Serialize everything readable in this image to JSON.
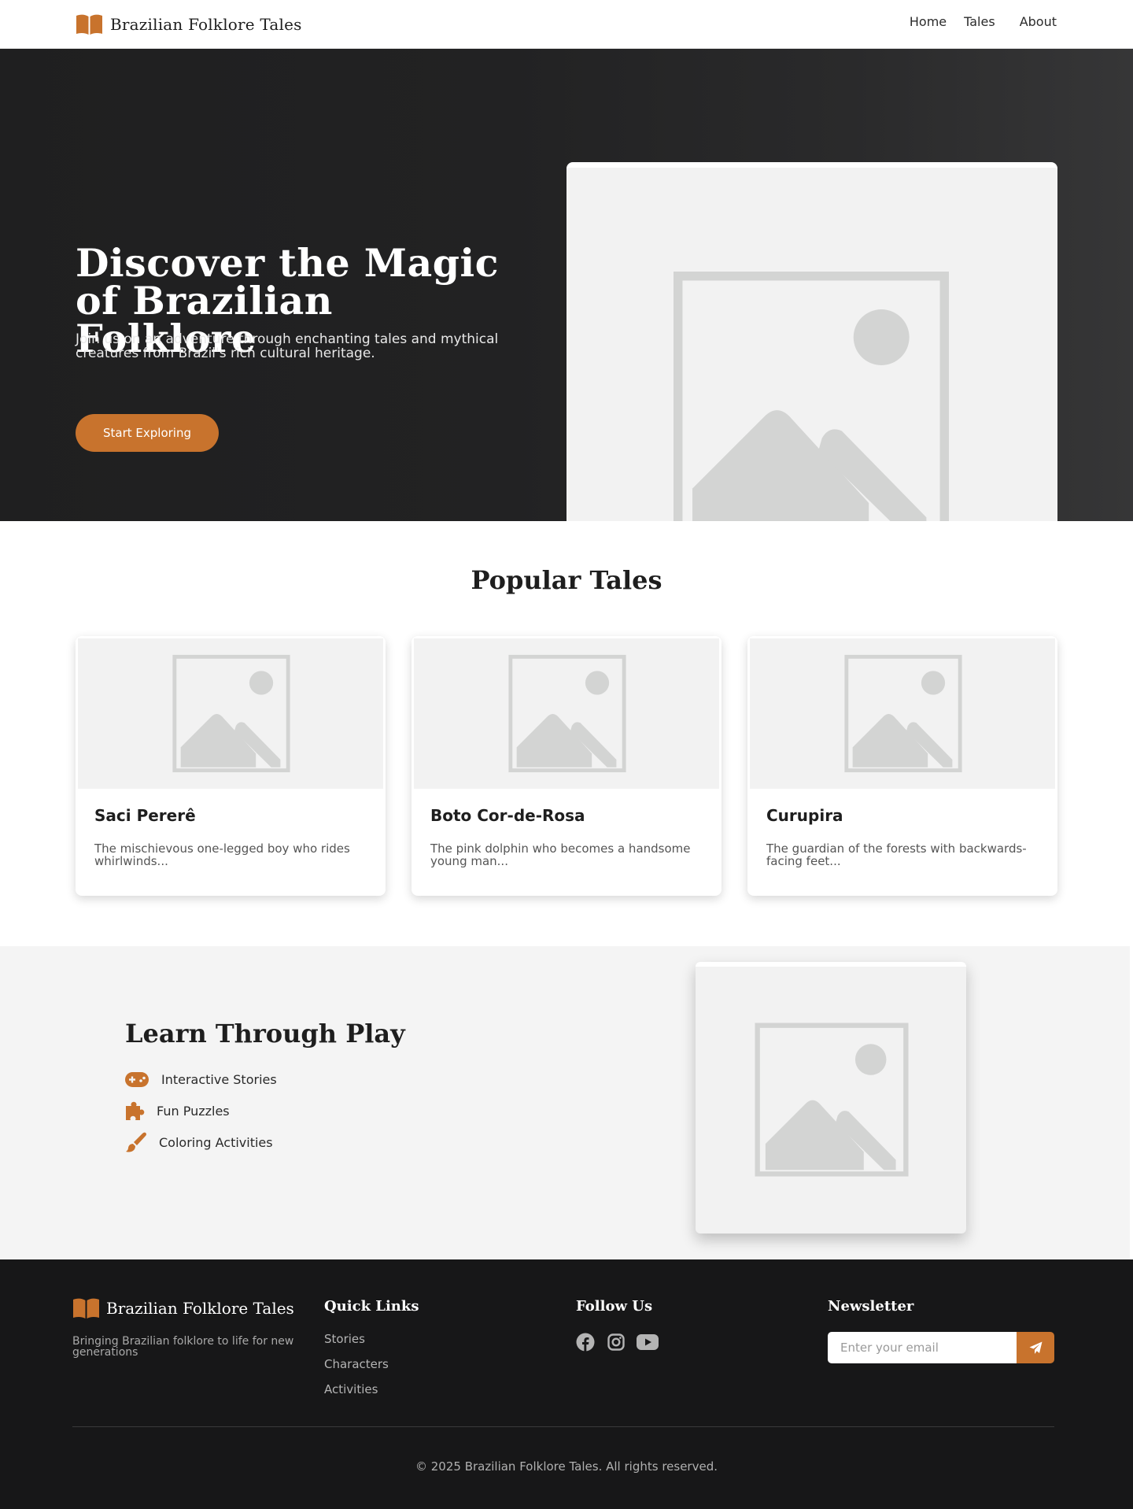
{
  "colors": {
    "accent": "#c8732d",
    "dark": "#1f1f20",
    "footer": "#171718",
    "placeholder_bg": "#f2f2f2",
    "placeholder_fg": "#d3d4d3"
  },
  "header": {
    "brand": "Brazilian Folklore Tales",
    "logo_icon": "open-book-icon",
    "nav": [
      {
        "label": "Home"
      },
      {
        "label": "Tales"
      },
      {
        "label": "About"
      }
    ]
  },
  "hero": {
    "title": "Discover the Magic of Brazilian Folklore",
    "subtitle": "Join us on an adventure through enchanting tales and mythical creatures from Brazil's rich cultural heritage.",
    "cta": "Start Exploring",
    "image_icon": "image-placeholder-icon"
  },
  "popular": {
    "title": "Popular Tales",
    "cards": [
      {
        "title": "Saci Pererê",
        "description": "The mischievous one-legged boy who rides whirlwinds..."
      },
      {
        "title": "Boto Cor-de-Rosa",
        "description": "The pink dolphin who becomes a handsome young man..."
      },
      {
        "title": "Curupira",
        "description": "The guardian of the forests with backwards-facing feet..."
      }
    ]
  },
  "learn": {
    "title": "Learn Through Play",
    "features": [
      {
        "label": "Interactive Stories",
        "icon": "gamepad-icon"
      },
      {
        "label": "Fun Puzzles",
        "icon": "puzzle-piece-icon"
      },
      {
        "label": "Coloring Activities",
        "icon": "paintbrush-icon"
      }
    ]
  },
  "footer": {
    "brand": "Brazilian Folklore Tales",
    "tagline": "Bringing Brazilian folklore to life for new generations",
    "quick_links_title": "Quick Links",
    "quick_links": [
      {
        "label": "Stories"
      },
      {
        "label": "Characters"
      },
      {
        "label": "Activities"
      }
    ],
    "follow_title": "Follow Us",
    "social": [
      {
        "icon": "facebook-icon"
      },
      {
        "icon": "instagram-icon"
      },
      {
        "icon": "youtube-icon"
      }
    ],
    "newsletter_title": "Newsletter",
    "newsletter_placeholder": "Enter your email",
    "newsletter_button_icon": "paper-plane-icon",
    "copyright": "© 2025 Brazilian Folklore Tales. All rights reserved."
  }
}
